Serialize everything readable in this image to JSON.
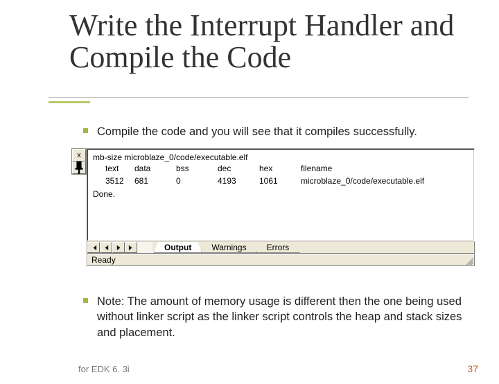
{
  "title": "Write the Interrupt Handler and Compile the Code",
  "bullet1": "Compile the code and you will see that it compiles successfully.",
  "bullet2": "Note:  The amount of memory usage is different then the one being used without linker script as the linker script controls the heap and stack sizes and placement.",
  "footer": "for EDK 6. 3i",
  "page_number": "37",
  "console": {
    "close_label": "x",
    "thumb_icon": "📌",
    "cmd": "mb-size microblaze_0/code/executable.elf",
    "headers": {
      "text": "text",
      "data": "data",
      "bss": "bss",
      "dec": "dec",
      "hex": "hex",
      "filename": "filename"
    },
    "values": {
      "text": "3512",
      "data": "681",
      "bss": "0",
      "dec": "4193",
      "hex": "1061",
      "filename": "microblaze_0/code/executable.elf"
    },
    "done": "Done.",
    "tabs": {
      "output": "Output",
      "warnings": "Warnings",
      "errors": "Errors"
    },
    "status": "Ready"
  }
}
